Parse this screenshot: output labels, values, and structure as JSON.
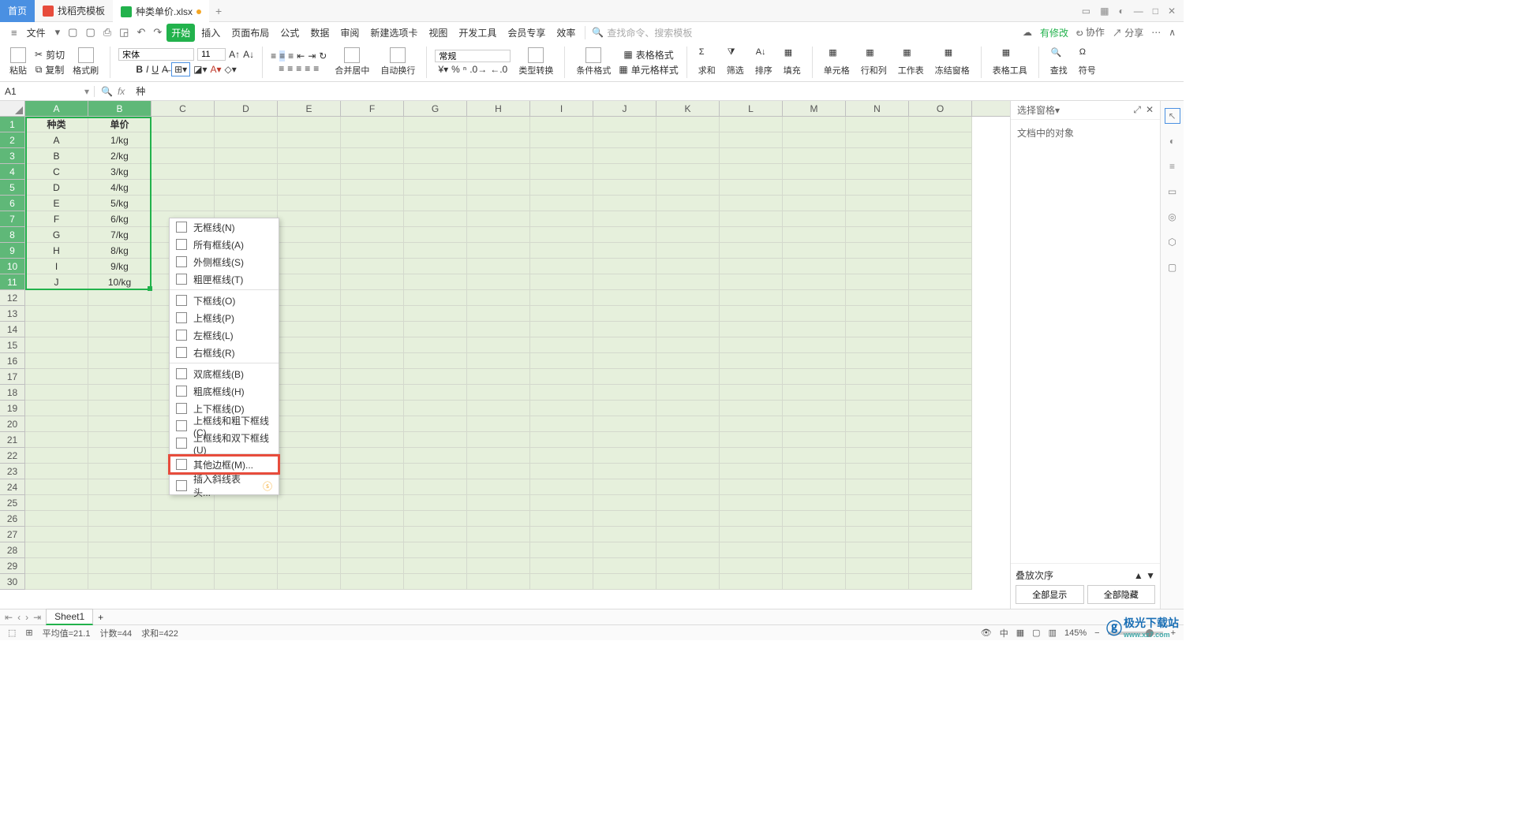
{
  "titlebar": {
    "home": "首页",
    "tab1": "找稻壳模板",
    "tab2": "种类单价.xlsx",
    "addtab": "+"
  },
  "menubar": {
    "file": "文件",
    "items": [
      "开始",
      "插入",
      "页面布局",
      "公式",
      "数据",
      "审阅",
      "新建选项卡",
      "视图",
      "开发工具",
      "会员专享",
      "效率"
    ],
    "search_placeholder": "查找命令、搜索模板",
    "search_icon": "Q",
    "modified": "有修改",
    "coop": "协作",
    "share": "分享"
  },
  "ribbon": {
    "paste": "粘贴",
    "cut": "剪切",
    "copy": "复制",
    "fmtpaint": "格式刷",
    "font_name": "宋体",
    "font_size": "11",
    "merge": "合并居中",
    "wrap": "自动换行",
    "numfmt": "常规",
    "typeconv": "类型转换",
    "condfmt": "条件格式",
    "tablestyle": "表格格式",
    "cellstyle": "单元格样式",
    "sum": "求和",
    "filter": "筛选",
    "sort": "排序",
    "fill": "填充",
    "cell": "单元格",
    "rowcol": "行和列",
    "sheet": "工作表",
    "freeze": "冻结窗格",
    "tabletool": "表格工具",
    "find": "查找",
    "symbol": "符号"
  },
  "fbar": {
    "name": "A1",
    "value": "种"
  },
  "columns": [
    "A",
    "B",
    "C",
    "D",
    "E",
    "F",
    "G",
    "H",
    "I",
    "J",
    "K",
    "L",
    "M",
    "N",
    "O"
  ],
  "rows": [
    "1",
    "2",
    "3",
    "4",
    "5",
    "6",
    "7",
    "8",
    "9",
    "10",
    "11",
    "12",
    "13",
    "14",
    "15",
    "16",
    "17",
    "18",
    "19",
    "20",
    "21",
    "22",
    "23",
    "24",
    "25",
    "26",
    "27",
    "28",
    "29",
    "30"
  ],
  "celldata": {
    "header": [
      "种类",
      "单价"
    ],
    "rows": [
      [
        "A",
        "1/kg"
      ],
      [
        "B",
        "2/kg"
      ],
      [
        "C",
        "3/kg"
      ],
      [
        "D",
        "4/kg"
      ],
      [
        "E",
        "5/kg"
      ],
      [
        "F",
        "6/kg"
      ],
      [
        "G",
        "7/kg"
      ],
      [
        "H",
        "8/kg"
      ],
      [
        "I",
        "9/kg"
      ],
      [
        "J",
        "10/kg"
      ]
    ]
  },
  "ddmenu": {
    "no_border": "无框线(N)",
    "all_border": "所有框线(A)",
    "outside": "外侧框线(S)",
    "thick": "粗匣框线(T)",
    "bottom": "下框线(O)",
    "top": "上框线(P)",
    "left": "左框线(L)",
    "right": "右框线(R)",
    "dbl_bottom": "双底框线(B)",
    "thick_bottom": "粗底框线(H)",
    "top_bottom": "上下框线(D)",
    "top_thick_bottom": "上框线和粗下框线(C)",
    "top_dbl_bottom": "上框线和双下框线(U)",
    "other": "其他边框(M)...",
    "diag": "插入斜线表头..."
  },
  "rpanel": {
    "title": "选择窗格",
    "subtitle": "文档中的对象",
    "order": "叠放次序",
    "showall": "全部显示",
    "hideall": "全部隐藏"
  },
  "sheettabs": {
    "sheet1": "Sheet1"
  },
  "status": {
    "avg": "平均值=21.1",
    "count": "计数=44",
    "sum": "求和=422",
    "zoom": "145%"
  },
  "watermark": {
    "t": "极光下载站",
    "s": "www.xz7.com"
  }
}
